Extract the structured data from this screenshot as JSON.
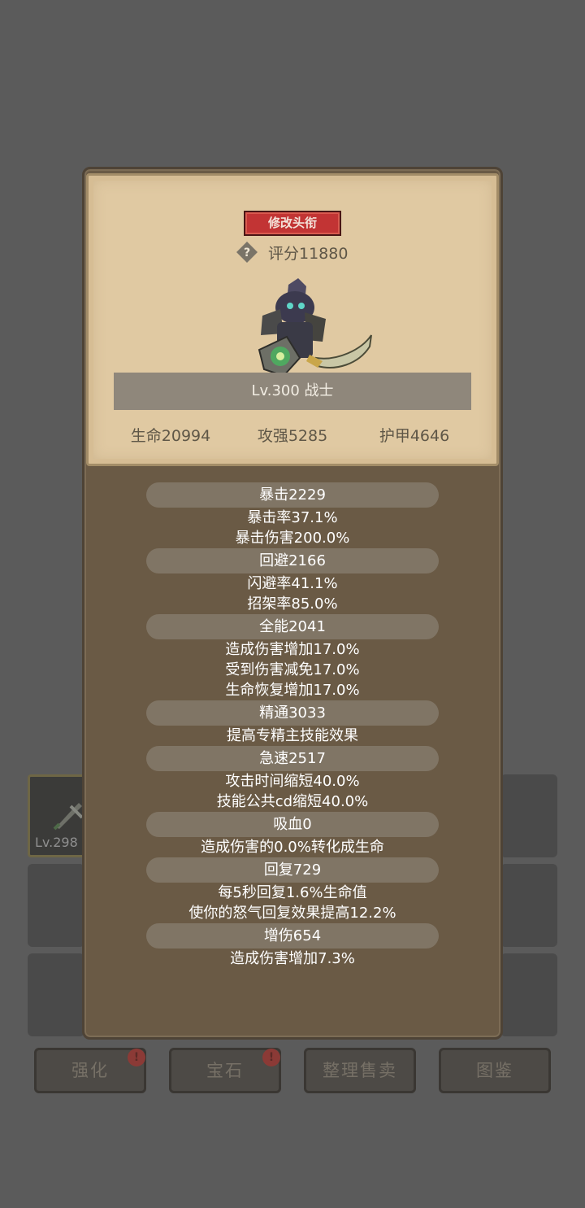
{
  "background": {
    "inventory_item_level": "Lv.298",
    "buttons": [
      {
        "label": "强化",
        "alert": "!"
      },
      {
        "label": "宝石",
        "alert": "!"
      },
      {
        "label": "整理售卖"
      },
      {
        "label": "图鉴"
      }
    ]
  },
  "card": {
    "title_button": "修改头衔",
    "help_icon": "question-icon",
    "score": "评分11880",
    "name_level": "Lv.300 战士",
    "main_stats": [
      "生命20994",
      "攻强5285",
      "护甲4646"
    ]
  },
  "stat_groups": [
    {
      "head": "暴击2229",
      "lines": [
        "暴击率37.1%",
        "暴击伤害200.0%"
      ]
    },
    {
      "head": "回避2166",
      "lines": [
        "闪避率41.1%",
        "招架率85.0%"
      ]
    },
    {
      "head": "全能2041",
      "lines": [
        "造成伤害增加17.0%",
        "受到伤害减免17.0%",
        "生命恢复增加17.0%"
      ]
    },
    {
      "head": "精通3033",
      "lines": [
        "提高专精主技能效果"
      ]
    },
    {
      "head": "急速2517",
      "lines": [
        "攻击时间缩短40.0%",
        "技能公共cd缩短40.0%"
      ]
    },
    {
      "head": "吸血0",
      "lines": [
        "造成伤害的0.0%转化成生命"
      ]
    },
    {
      "head": "回复729",
      "lines": [
        "每5秒回复1.6%生命值",
        "使你的怒气回复效果提高12.2%"
      ]
    },
    {
      "head": "增伤654",
      "lines": [
        "造成伤害增加7.3%"
      ]
    }
  ],
  "colors": {
    "backdrop": "#5b5b5b",
    "panel": "#6a5a45",
    "card": "#e0c9a2",
    "title_button": "#c23434"
  }
}
